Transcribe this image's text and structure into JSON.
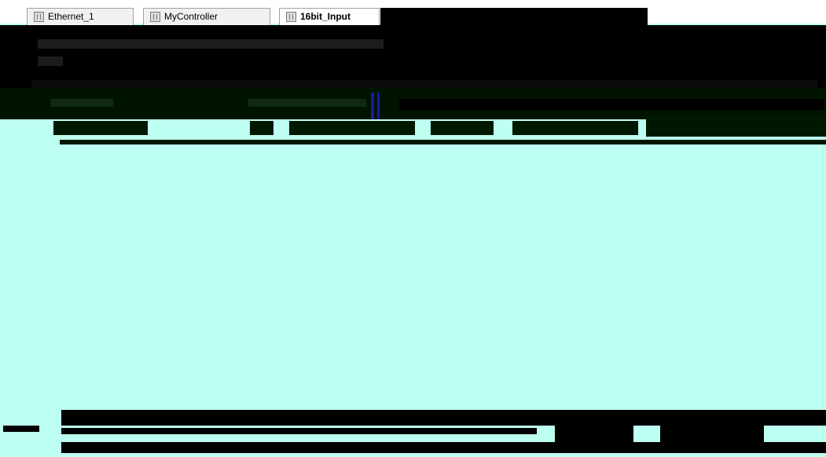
{
  "tabs": [
    {
      "label": "Ethernet_1"
    },
    {
      "label": "MyController"
    },
    {
      "label": "16bit_Input"
    }
  ],
  "colors": {
    "background": "#bdfff0",
    "header": "#000000",
    "strip": "#001400"
  }
}
